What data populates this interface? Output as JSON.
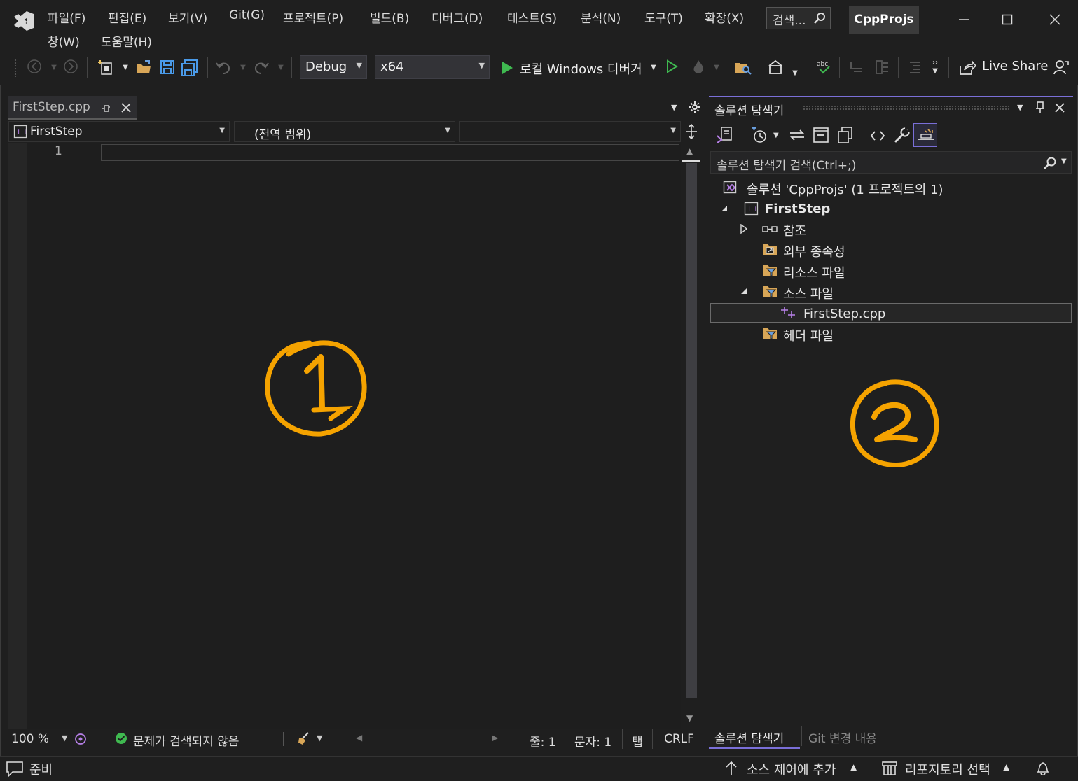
{
  "title_bar": {
    "menu": [
      "파일(F)",
      "편집(E)",
      "보기(V)",
      "Git(G)",
      "프로젝트(P)",
      "빌드(B)",
      "디버그(D)",
      "테스트(S)",
      "분석(N)",
      "도구(T)",
      "확장(X)",
      "창(W)",
      "도움말(H)"
    ],
    "search_label": "검색...",
    "solution_name": "CppProjs"
  },
  "toolbar": {
    "configuration": "Debug",
    "platform": "x64",
    "run_label": "로컬 Windows 디버거",
    "live_share": "Live Share"
  },
  "editor": {
    "tab_name": "FirstStep.cpp",
    "nav_project": "FirstStep",
    "nav_scope": "(전역 범위)",
    "nav_member": "",
    "line_number": "1",
    "zoom": "100 %",
    "issues": "문제가 검색되지 않음",
    "line_status": "줄: 1",
    "char_status": "문자: 1",
    "indent_mode": "탭",
    "line_ending": "CRLF"
  },
  "solution_explorer": {
    "title": "솔루션 탐색기",
    "search_placeholder": "솔루션 탐색기 검색(Ctrl+;)",
    "solution_node": "솔루션 'CppProjs' (1 프로젝트의 1)",
    "project_node": "FirstStep",
    "items": [
      "참조",
      "외부 종속성",
      "리소스 파일",
      "소스 파일",
      "FirstStep.cpp",
      "헤더 파일"
    ],
    "bottom_tabs": [
      "솔루션 탐색기",
      "Git 변경 내용"
    ]
  },
  "status_bar": {
    "ready": "준비",
    "add_source_control": "소스 제어에 추가",
    "select_repo": "리포지토리 선택"
  },
  "annotations": [
    "1",
    "2"
  ],
  "colors": {
    "accent": "#7a6fd8",
    "annotation": "#f5a300",
    "run_green": "#3fb950",
    "folder": "#d8a657",
    "cpp_purple": "#b780e8"
  }
}
